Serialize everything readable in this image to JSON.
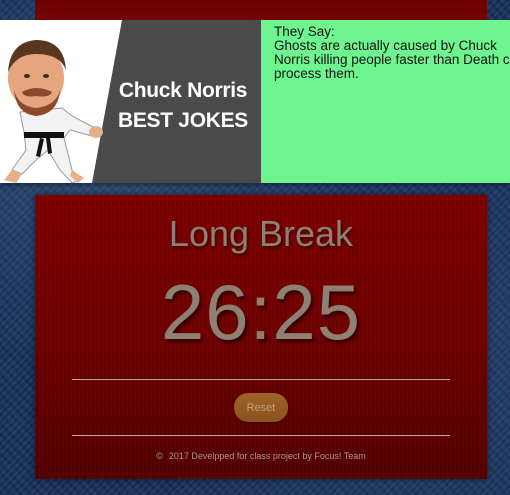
{
  "banner": {
    "title_line1": "Chuck Norris",
    "title_line2": "BEST JOKES",
    "joke_label": "They Say:",
    "joke_text": "Ghosts are actually caused by Chuck Norris killing people faster than Death can process them."
  },
  "timer": {
    "mode": "Long Break",
    "time": "26:25",
    "reset_label": "Reset"
  },
  "footer": {
    "copyright_symbol": "©",
    "text": "2017 Develpped for class project by Focus! Team"
  },
  "colors": {
    "page_background": "#17305a",
    "card_background": "#6d0000",
    "banner_joke_background": "#6ef58f",
    "text_muted": "#8e8073",
    "reset_button": "#8a5220"
  }
}
